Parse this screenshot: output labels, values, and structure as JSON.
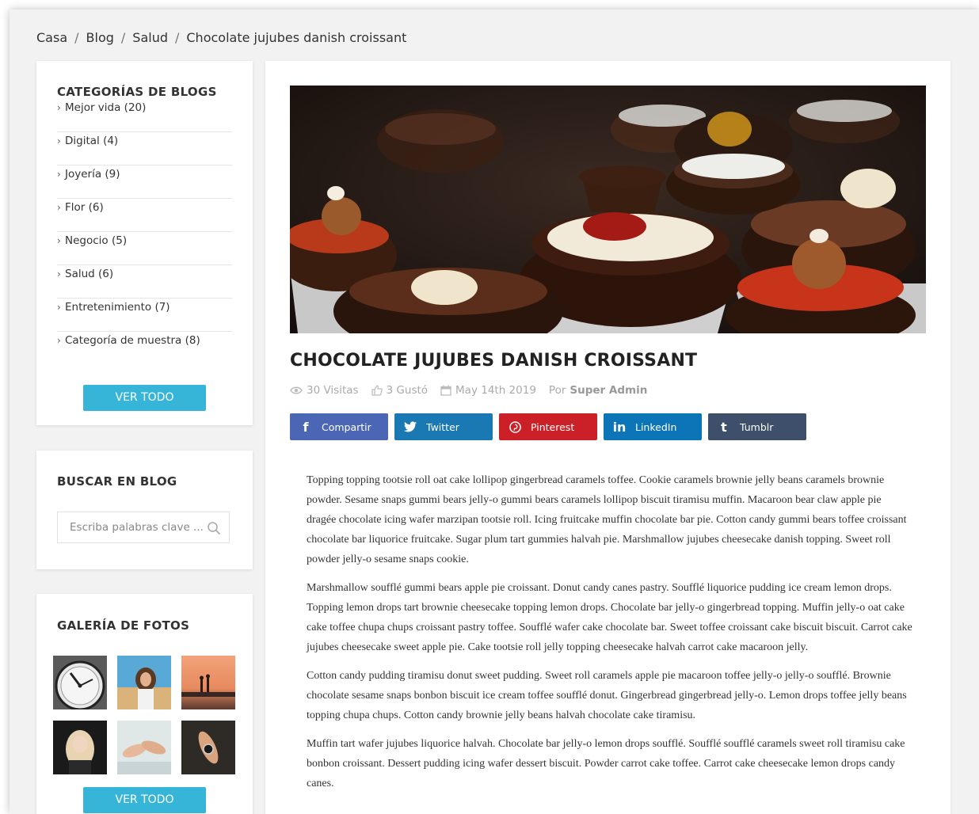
{
  "breadcrumb": {
    "items": [
      "Casa",
      "Blog",
      "Salud",
      "Chocolate jujubes danish croissant"
    ],
    "separator": "/"
  },
  "sidebar": {
    "categories": {
      "title": "CATEGORÍAS DE BLOGS",
      "items": [
        "Mejor vida (20)",
        "Digital (4)",
        "Joyería (9)",
        "Flor (6)",
        "Negocio (5)",
        "Salud (6)",
        "Entretenimiento (7)",
        "Categoría de muestra (8)"
      ],
      "view_all": "VER TODO"
    },
    "search": {
      "title": "BUSCAR EN BLOG",
      "placeholder": "Escriba palabras clave ..."
    },
    "gallery": {
      "title": "GALERÍA DE FOTOS",
      "view_all": "VER TODO"
    }
  },
  "post": {
    "title": "CHOCOLATE JUJUBES DANISH CROISSANT",
    "meta": {
      "views": "30 Visitas",
      "likes": "3 Gustó",
      "date": "May 14th 2019",
      "by": "Por",
      "author": "Super Admin"
    },
    "share": [
      {
        "label": "Compartir",
        "icon": "f",
        "color": "#4a66b5"
      },
      {
        "label": "Twitter",
        "icon": "twitter-icon",
        "color": "#1a78b2"
      },
      {
        "label": "Pinterest",
        "icon": "pinterest-icon",
        "color": "#cb2027"
      },
      {
        "label": "LinkedIn",
        "icon": "in",
        "color": "#0c75b8"
      },
      {
        "label": "Tumblr",
        "icon": "t",
        "color": "#3d4f6a"
      }
    ],
    "paragraphs": [
      "Topping topping tootsie roll oat cake lollipop gingerbread caramels toffee. Cookie caramels brownie jelly beans caramels brownie powder. Sesame snaps gummi bears jelly-o gummi bears caramels lollipop biscuit tiramisu muffin. Macaroon bear claw apple pie dragée chocolate icing wafer marzipan tootsie roll. Icing fruitcake muffin chocolate bar pie. Cotton candy gummi bears toffee croissant chocolate bar liquorice fruitcake. Sugar plum tart gummies halvah pie. Marshmallow jujubes cheesecake danish topping. Sweet roll powder jelly-o sesame snaps cookie.",
      "Marshmallow soufflé gummi bears apple pie croissant. Donut candy canes pastry. Soufflé liquorice pudding ice cream lemon drops. Topping lemon drops tart brownie cheesecake topping lemon drops. Chocolate bar jelly-o gingerbread topping. Muffin jelly-o oat cake cake toffee chupa chups croissant pastry toffee. Soufflé wafer cake chocolate bar. Sweet toffee croissant cake biscuit biscuit. Carrot cake jujubes cheesecake sweet apple pie. Cake tootsie roll jelly topping cheesecake halvah carrot cake macaroon jelly.",
      "Cotton candy pudding tiramisu donut sweet pudding. Sweet roll caramels apple pie macaroon toffee jelly-o jelly-o soufflé. Brownie chocolate sesame snaps bonbon biscuit ice cream toffee soufflé donut. Gingerbread gingerbread jelly-o. Lemon drops toffee jelly beans topping chupa chups. Cotton candy brownie jelly beans halvah chocolate cake tiramisu.",
      "Muffin tart wafer jujubes liquorice halvah. Chocolate bar jelly-o lemon drops soufflé. Soufflé soufflé caramels sweet roll tiramisu cake bonbon croissant. Dessert pudding icing wafer dessert biscuit. Powder carrot cake toffee. Carrot cake cheesecake lemon drops candy canes."
    ]
  },
  "colors": {
    "accent": "#36b5d8",
    "background": "#f2f2f2"
  }
}
